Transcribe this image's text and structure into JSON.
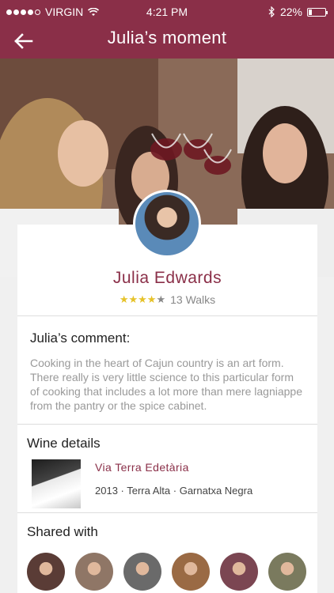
{
  "status_bar": {
    "signal_dots_filled": 4,
    "signal_dots_total": 5,
    "carrier": "VIRGIN",
    "wifi_icon": "wifi-icon",
    "time": "4:21 PM",
    "bluetooth_icon": "bluetooth-icon",
    "battery_percent": "22%",
    "battery_level": 0.22
  },
  "nav": {
    "back_icon": "back-arrow-icon",
    "title": "Julia’s moment"
  },
  "hero": {
    "image": "friends-toasting-wine-photo"
  },
  "profile": {
    "avatar": "julia-avatar-photo",
    "name": "Julia Edwards",
    "rating": 4,
    "rating_max": 5,
    "walks": "13 Walks"
  },
  "comment": {
    "heading": "Julia’s comment:",
    "text": "Cooking in the heart of Cajun country is an art form. There really is very little science to this particular form of cooking that includes a lot more than mere lagniappe from the pantry or the spice cabinet."
  },
  "wine": {
    "heading": "Wine details",
    "image": "wine-bottle-photo",
    "name": "Via Terra Edetària",
    "meta": "2013 · Terra Alta · Garnatxa Negra"
  },
  "shared": {
    "heading": "Shared with",
    "people": [
      {
        "avatar": "shared-avatar-1",
        "color": "#5a3c36"
      },
      {
        "avatar": "shared-avatar-2",
        "color": "#8f7666"
      },
      {
        "avatar": "shared-avatar-3",
        "color": "#6a6a6a"
      },
      {
        "avatar": "shared-avatar-4",
        "color": "#9a6a44"
      },
      {
        "avatar": "shared-avatar-5",
        "color": "#7b4652"
      },
      {
        "avatar": "shared-avatar-6",
        "color": "#7a7a5e"
      }
    ]
  },
  "colors": {
    "brand": "#8a2f48",
    "star": "#e6c229"
  }
}
